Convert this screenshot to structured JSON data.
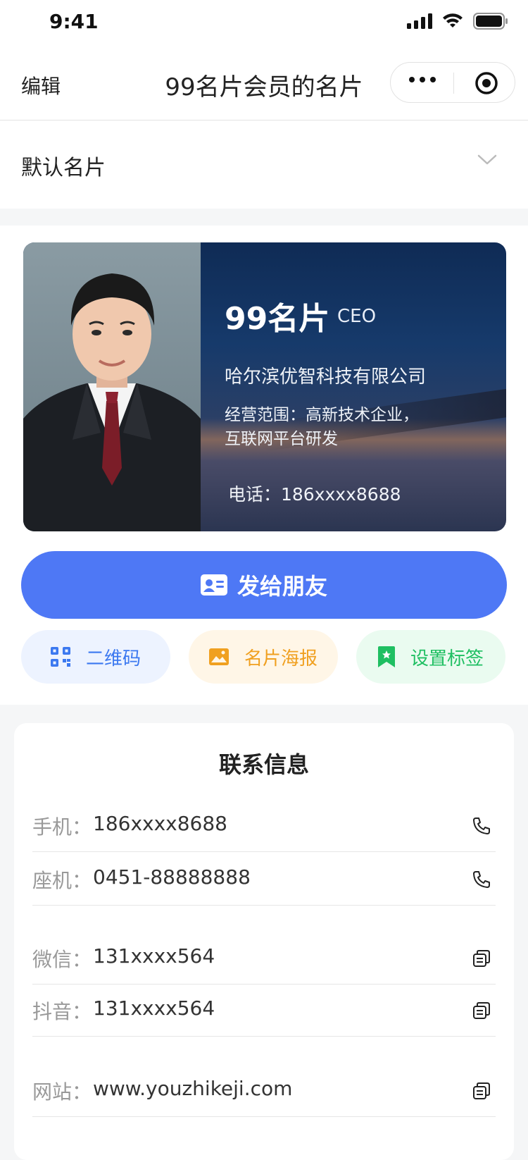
{
  "status": {
    "time": "9:41"
  },
  "nav": {
    "edit": "编辑",
    "title": "99名片会员的名片"
  },
  "card_select": {
    "label": "默认名片"
  },
  "card": {
    "name": "99名片",
    "role": "CEO",
    "company": "哈尔滨优智科技有限公司",
    "scope_line1": "经营范围：高新技术企业，",
    "scope_line2": "互联网平台研发",
    "phone": "电话：186xxxx8688"
  },
  "actions": {
    "send": "发给朋友",
    "qr": "二维码",
    "poster": "名片海报",
    "tag": "设置标签"
  },
  "contact": {
    "title": "联系信息",
    "rows": [
      {
        "key": "手机：",
        "value": "186xxxx8688",
        "icon": "phone-icon"
      },
      {
        "key": "座机：",
        "value": "0451-88888888",
        "icon": "phone-icon"
      },
      {
        "key": "微信：",
        "value": "131xxxx564",
        "icon": "copy-icon"
      },
      {
        "key": "抖音：",
        "value": "131xxxx564",
        "icon": "copy-icon"
      },
      {
        "key": "网站：",
        "value": "www.youzhikeji.com",
        "icon": "copy-icon"
      }
    ]
  },
  "colors": {
    "primary": "#4e78f5",
    "qr": "#3b78f0",
    "poster": "#f0a020",
    "tag": "#1fbf62"
  }
}
